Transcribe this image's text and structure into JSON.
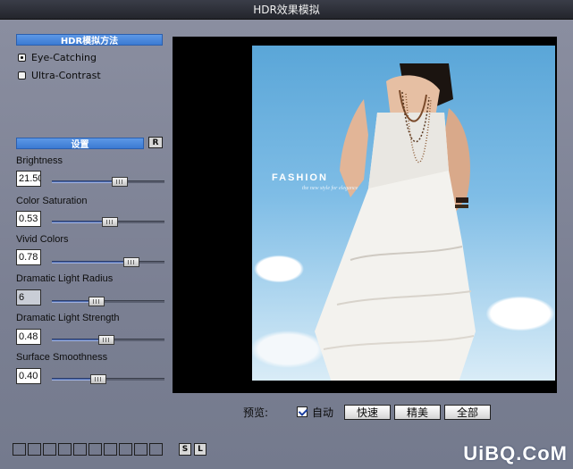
{
  "window": {
    "title": "HDR效果模拟"
  },
  "method": {
    "header": "HDR模拟方法",
    "options": [
      {
        "label": "Eye-Catching",
        "checked": true
      },
      {
        "label": "Ultra-Contrast",
        "checked": false
      }
    ]
  },
  "settings": {
    "header": "设置",
    "reset_label": "R",
    "params": [
      {
        "label": "Brightness",
        "value": "21.50",
        "level": 0.62
      },
      {
        "label": "Color Saturation",
        "value": "0.53",
        "level": 0.52
      },
      {
        "label": "Vivid Colors",
        "value": "0.78",
        "level": 0.74
      },
      {
        "label": "Dramatic Light Radius",
        "value": "6",
        "level": 0.38
      },
      {
        "label": "Dramatic Light Strength",
        "value": "0.48",
        "level": 0.48
      },
      {
        "label": "Surface Smoothness",
        "value": "0.40",
        "level": 0.4
      }
    ]
  },
  "preview": {
    "photo_text": "FASHION",
    "photo_subtext": "the new style for elegance",
    "label": "预览:",
    "auto_label": "自动",
    "auto_checked": true,
    "buttons": {
      "fast": "快速",
      "fine": "精美",
      "all": "全部"
    }
  },
  "presets": {
    "save_label": "S",
    "load_label": "L",
    "slot_count": 10
  },
  "watermark": "UiBQ.CoM",
  "colors": {
    "header_blue": "#3b7ad2",
    "panel": "#7e8396"
  }
}
